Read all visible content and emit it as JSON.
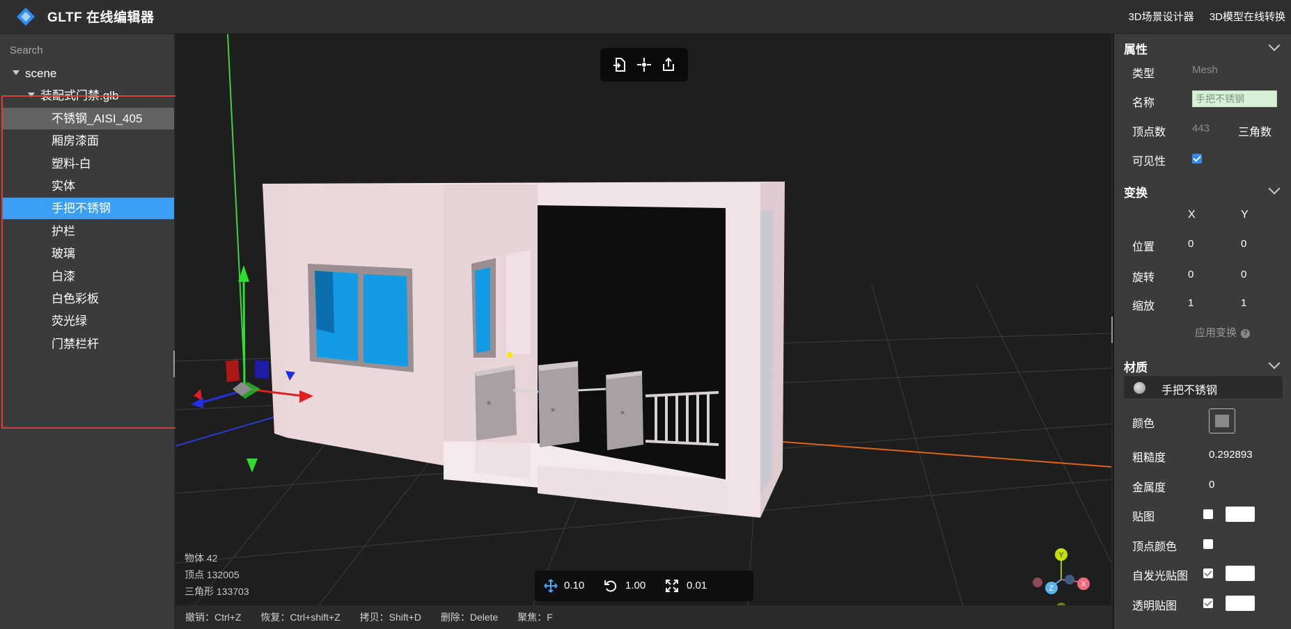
{
  "header": {
    "title": "GLTF 在线编辑器",
    "links": [
      "3D场景设计器",
      "3D模型在线转换"
    ]
  },
  "outliner": {
    "search_placeholder": "Search",
    "items": [
      {
        "label": "scene",
        "level": 0,
        "expanded": true
      },
      {
        "label": "装配式门禁.glb",
        "level": 1,
        "expanded": true
      },
      {
        "label": "不锈钢_AISI_405",
        "level": 2
      },
      {
        "label": "厢房漆面",
        "level": 2
      },
      {
        "label": "塑料-白",
        "level": 2
      },
      {
        "label": "实体",
        "level": 2
      },
      {
        "label": "手把不锈钢",
        "level": 2,
        "selected": true
      },
      {
        "label": "护栏",
        "level": 2
      },
      {
        "label": "玻璃",
        "level": 2
      },
      {
        "label": "白漆",
        "level": 2
      },
      {
        "label": "白色彩板",
        "level": 2
      },
      {
        "label": "荧光绿",
        "level": 2
      },
      {
        "label": "门禁栏杆",
        "level": 2
      }
    ]
  },
  "viewport": {
    "stats": {
      "objects": "物体 42",
      "vertices": "顶点 132005",
      "triangles": "三角形 133703"
    },
    "transform_bar": {
      "translate": "0.10",
      "rotate": "1.00",
      "scale": "0.01"
    },
    "shortcuts": [
      "撤销：Ctrl+Z",
      "恢复：Ctrl+shift+Z",
      "拷贝：Shift+D",
      "删除：Delete",
      "聚焦：F"
    ],
    "gizmo_labels": {
      "x": "X",
      "y": "Y",
      "z": "Z"
    }
  },
  "properties": {
    "title": "属性",
    "type_label": "类型",
    "type_value": "Mesh",
    "name_label": "名称",
    "name_value": "手把不锈钢",
    "vertex_label": "顶点数",
    "vertex_value": "443",
    "triangle_label": "三角数",
    "visible_label": "可见性",
    "visible": true
  },
  "transform": {
    "title": "变换",
    "col_x": "X",
    "col_y": "Y",
    "position_label": "位置",
    "position": [
      "0",
      "0"
    ],
    "rotation_label": "旋转",
    "rotation": [
      "0",
      "0"
    ],
    "scale_label": "缩放",
    "scale": [
      "1",
      "1"
    ],
    "apply_label": "应用变换",
    "help": "?"
  },
  "material": {
    "title": "材质",
    "name": "手把不锈钢",
    "color_label": "颜色",
    "color": "#8a8a8a",
    "roughness_label": "粗糙度",
    "roughness": "0.292893",
    "metalness_label": "金属度",
    "metalness": "0",
    "map_label": "贴图",
    "vertex_color_label": "顶点颜色",
    "emissive_map_label": "自发光贴图",
    "alpha_map_label": "透明贴图"
  },
  "colors": {
    "accent": "#3ba0f5",
    "highlight_border": "#e53935"
  }
}
